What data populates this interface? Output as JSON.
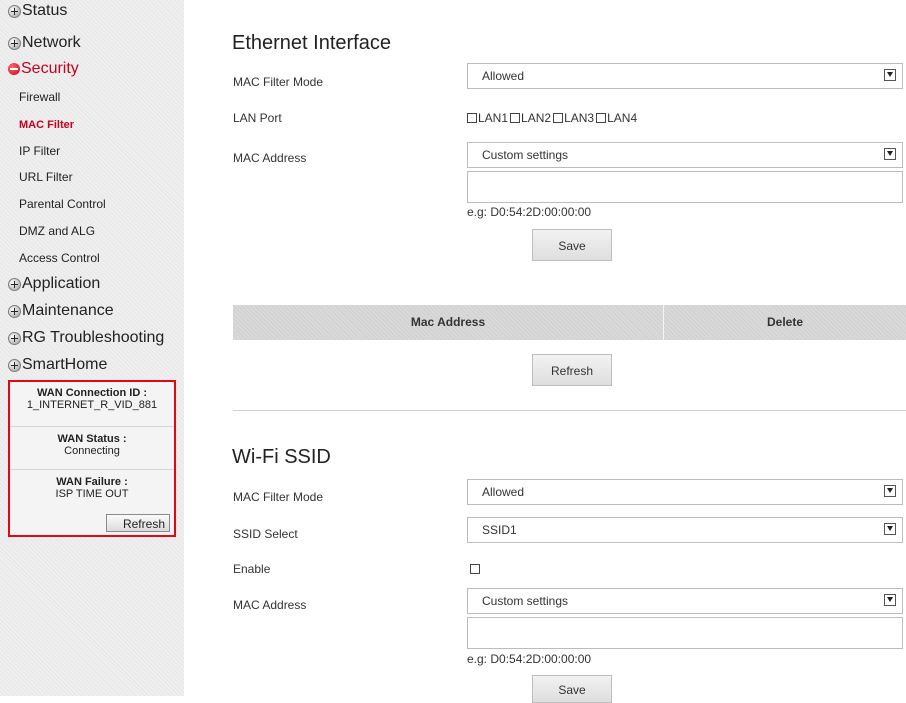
{
  "sidebar": {
    "top_items": [
      {
        "label": "Status"
      },
      {
        "label": "Network"
      },
      {
        "label": "Security"
      },
      {
        "label": "Application"
      },
      {
        "label": "Maintenance"
      },
      {
        "label": "RG Troubleshooting"
      },
      {
        "label": "SmartHome"
      }
    ],
    "security_sub_items": [
      {
        "label": "Firewall"
      },
      {
        "label": "MAC Filter"
      },
      {
        "label": "IP Filter"
      },
      {
        "label": "URL Filter"
      },
      {
        "label": "Parental Control"
      },
      {
        "label": "DMZ and ALG"
      },
      {
        "label": "Access Control"
      }
    ],
    "active_item": "MAC Filter",
    "wan_box": {
      "connection_id_label": "WAN Connection ID :",
      "connection_id_value": "1_INTERNET_R_VID_881",
      "status_label": "WAN Status :",
      "status_value": "Connecting",
      "failure_label": "WAN Failure :",
      "failure_value": "ISP TIME OUT",
      "refresh_label": "Refresh",
      "border_color": "#e30613"
    }
  },
  "ethernet": {
    "title": "Ethernet Interface",
    "mac_filter_mode_label": "MAC Filter Mode",
    "mac_filter_mode_value": "Allowed",
    "lan_port_label": "LAN Port",
    "lan_ports": [
      "LAN1",
      "LAN2",
      "LAN3",
      "LAN4"
    ],
    "mac_address_label": "MAC Address",
    "mac_address_select_value": "Custom settings",
    "mac_address_input_value": "",
    "mac_example": "e.g: D0:54:2D:00:00:00",
    "save_label": "Save"
  },
  "table": {
    "columns": [
      "Mac Address",
      "Delete"
    ],
    "refresh_label": "Refresh"
  },
  "wifi": {
    "title": "Wi-Fi SSID",
    "mac_filter_mode_label": "MAC Filter Mode",
    "mac_filter_mode_value": "Allowed",
    "ssid_select_label": "SSID Select",
    "ssid_select_value": "SSID1",
    "enable_label": "Enable",
    "mac_address_label": "MAC Address",
    "mac_address_select_value": "Custom settings",
    "mac_address_input_value": "",
    "mac_example": "e.g: D0:54:2D:00:00:00",
    "save_label": "Save"
  },
  "colors": {
    "accent_red": "#c6001e",
    "sidebar_bg": "#efefef",
    "table_header_bg": "#d9d9d9"
  }
}
